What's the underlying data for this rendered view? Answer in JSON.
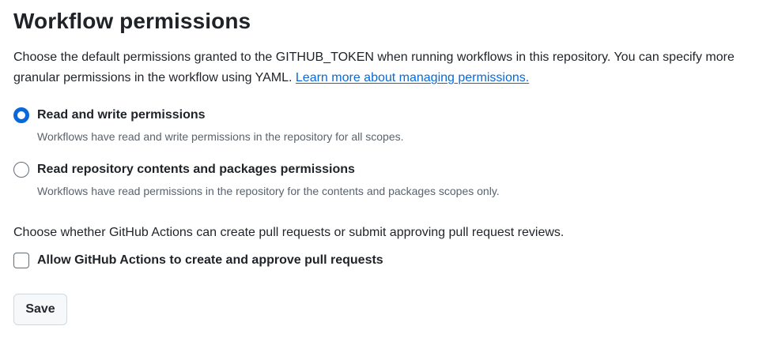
{
  "header": {
    "title": "Workflow permissions"
  },
  "description": {
    "text": "Choose the default permissions granted to the GITHUB_TOKEN when running workflows in this repository. You can specify more granular permissions in the workflow using YAML. ",
    "link_label": "Learn more about managing permissions."
  },
  "permissions": {
    "options": [
      {
        "label": "Read and write permissions",
        "note": "Workflows have read and write permissions in the repository for all scopes.",
        "selected": true
      },
      {
        "label": "Read repository contents and packages permissions",
        "note": "Workflows have read permissions in the repository for the contents and packages scopes only.",
        "selected": false
      }
    ]
  },
  "pull_requests": {
    "text": "Choose whether GitHub Actions can create pull requests or submit approving pull request reviews.",
    "checkbox_label": "Allow GitHub Actions to create and approve pull requests",
    "checked": false
  },
  "actions": {
    "save_label": "Save"
  },
  "colors": {
    "accent": "#0969da",
    "text": "#1f2328",
    "muted": "#59636e",
    "border": "#d1d9e0"
  }
}
